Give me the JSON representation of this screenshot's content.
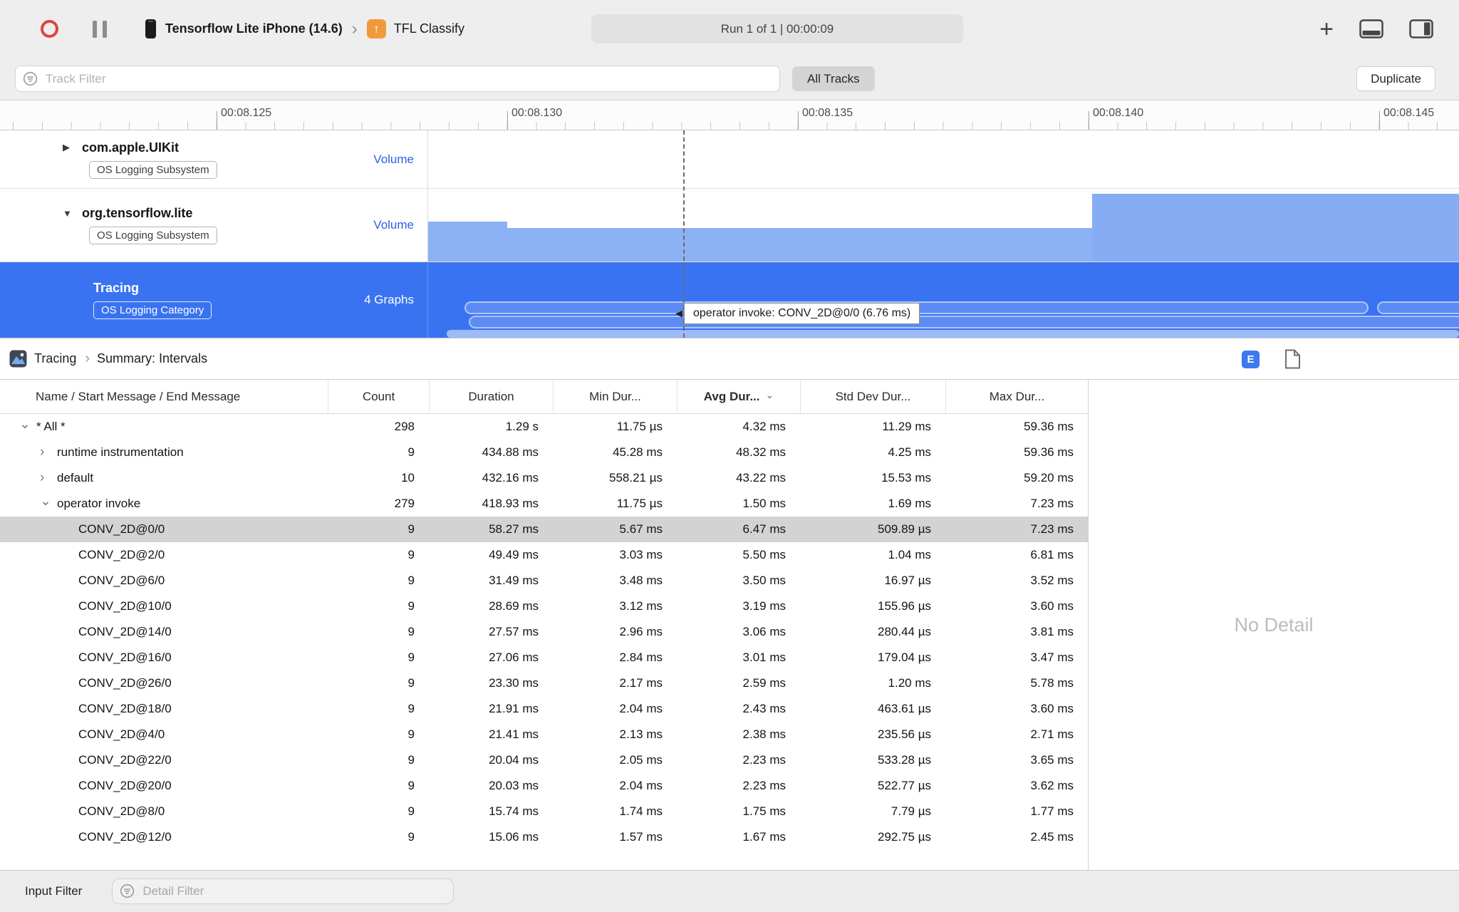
{
  "toolbar": {
    "device": "Tensorflow Lite iPhone (14.6)",
    "target": "TFL Classify",
    "run_status": "Run 1 of 1  |  00:00:09"
  },
  "filter_bar": {
    "track_filter_placeholder": "Track Filter",
    "all_tracks_label": "All Tracks",
    "duplicate_label": "Duplicate"
  },
  "ruler": {
    "ticks": [
      "00:08.125",
      "00:08.130",
      "00:08.135",
      "00:08.140",
      "00:08.145"
    ]
  },
  "tracks": [
    {
      "name": "com.apple.UIKit",
      "badge": "OS Logging Subsystem",
      "meta": "Volume",
      "state": "collapsed"
    },
    {
      "name": "org.tensorflow.lite",
      "badge": "OS Logging Subsystem",
      "meta": "Volume",
      "state": "expanded"
    },
    {
      "name": "Tracing",
      "badge": "OS Logging Category",
      "meta": "4 Graphs",
      "state": "selected"
    }
  ],
  "timeline": {
    "tooltip": "operator invoke: CONV_2D@0/0 (6.76 ms)"
  },
  "detail": {
    "breadcrumb": [
      "Tracing",
      "Summary: Intervals"
    ],
    "editor_badge": "E",
    "no_detail": "No Detail",
    "columns": [
      "Name / Start Message / End Message",
      "Count",
      "Duration",
      "Min Dur...",
      "Avg Dur...",
      "Std Dev Dur...",
      "Max Dur..."
    ],
    "sorted_column_index": 4,
    "rows": [
      {
        "level": 0,
        "expander": "open",
        "selected": false,
        "name": "* All *",
        "count": "298",
        "duration": "1.29 s",
        "min": "11.75 µs",
        "avg": "4.32 ms",
        "std": "11.29 ms",
        "max": "59.36 ms"
      },
      {
        "level": 1,
        "expander": "closed",
        "selected": false,
        "name": "runtime instrumentation",
        "count": "9",
        "duration": "434.88 ms",
        "min": "45.28 ms",
        "avg": "48.32 ms",
        "std": "4.25 ms",
        "max": "59.36 ms"
      },
      {
        "level": 1,
        "expander": "closed",
        "selected": false,
        "name": "default",
        "count": "10",
        "duration": "432.16 ms",
        "min": "558.21 µs",
        "avg": "43.22 ms",
        "std": "15.53 ms",
        "max": "59.20 ms"
      },
      {
        "level": 1,
        "expander": "open",
        "selected": false,
        "name": "operator invoke",
        "count": "279",
        "duration": "418.93 ms",
        "min": "11.75 µs",
        "avg": "1.50 ms",
        "std": "1.69 ms",
        "max": "7.23 ms"
      },
      {
        "level": 2,
        "expander": null,
        "selected": true,
        "name": "CONV_2D@0/0",
        "count": "9",
        "duration": "58.27 ms",
        "min": "5.67 ms",
        "avg": "6.47 ms",
        "std": "509.89 µs",
        "max": "7.23 ms"
      },
      {
        "level": 2,
        "expander": null,
        "selected": false,
        "name": "CONV_2D@2/0",
        "count": "9",
        "duration": "49.49 ms",
        "min": "3.03 ms",
        "avg": "5.50 ms",
        "std": "1.04 ms",
        "max": "6.81 ms"
      },
      {
        "level": 2,
        "expander": null,
        "selected": false,
        "name": "CONV_2D@6/0",
        "count": "9",
        "duration": "31.49 ms",
        "min": "3.48 ms",
        "avg": "3.50 ms",
        "std": "16.97 µs",
        "max": "3.52 ms"
      },
      {
        "level": 2,
        "expander": null,
        "selected": false,
        "name": "CONV_2D@10/0",
        "count": "9",
        "duration": "28.69 ms",
        "min": "3.12 ms",
        "avg": "3.19 ms",
        "std": "155.96 µs",
        "max": "3.60 ms"
      },
      {
        "level": 2,
        "expander": null,
        "selected": false,
        "name": "CONV_2D@14/0",
        "count": "9",
        "duration": "27.57 ms",
        "min": "2.96 ms",
        "avg": "3.06 ms",
        "std": "280.44 µs",
        "max": "3.81 ms"
      },
      {
        "level": 2,
        "expander": null,
        "selected": false,
        "name": "CONV_2D@16/0",
        "count": "9",
        "duration": "27.06 ms",
        "min": "2.84 ms",
        "avg": "3.01 ms",
        "std": "179.04 µs",
        "max": "3.47 ms"
      },
      {
        "level": 2,
        "expander": null,
        "selected": false,
        "name": "CONV_2D@26/0",
        "count": "9",
        "duration": "23.30 ms",
        "min": "2.17 ms",
        "avg": "2.59 ms",
        "std": "1.20 ms",
        "max": "5.78 ms"
      },
      {
        "level": 2,
        "expander": null,
        "selected": false,
        "name": "CONV_2D@18/0",
        "count": "9",
        "duration": "21.91 ms",
        "min": "2.04 ms",
        "avg": "2.43 ms",
        "std": "463.61 µs",
        "max": "3.60 ms"
      },
      {
        "level": 2,
        "expander": null,
        "selected": false,
        "name": "CONV_2D@4/0",
        "count": "9",
        "duration": "21.41 ms",
        "min": "2.13 ms",
        "avg": "2.38 ms",
        "std": "235.56 µs",
        "max": "2.71 ms"
      },
      {
        "level": 2,
        "expander": null,
        "selected": false,
        "name": "CONV_2D@22/0",
        "count": "9",
        "duration": "20.04 ms",
        "min": "2.05 ms",
        "avg": "2.23 ms",
        "std": "533.28 µs",
        "max": "3.65 ms"
      },
      {
        "level": 2,
        "expander": null,
        "selected": false,
        "name": "CONV_2D@20/0",
        "count": "9",
        "duration": "20.03 ms",
        "min": "2.04 ms",
        "avg": "2.23 ms",
        "std": "522.77 µs",
        "max": "3.62 ms"
      },
      {
        "level": 2,
        "expander": null,
        "selected": false,
        "name": "CONV_2D@8/0",
        "count": "9",
        "duration": "15.74 ms",
        "min": "1.74 ms",
        "avg": "1.75 ms",
        "std": "7.79 µs",
        "max": "1.77 ms"
      },
      {
        "level": 2,
        "expander": null,
        "selected": false,
        "name": "CONV_2D@12/0",
        "count": "9",
        "duration": "15.06 ms",
        "min": "1.57 ms",
        "avg": "1.67 ms",
        "std": "292.75 µs",
        "max": "2.45 ms"
      }
    ]
  },
  "bottom_bar": {
    "input_filter_label": "Input Filter",
    "detail_filter_placeholder": "Detail Filter"
  },
  "icons": {
    "add": "+",
    "toolbar_chevron": "›",
    "breadcrumb_chevron": "›",
    "sort_chevron": "⌄",
    "tooltip_arrow": "◀",
    "collapsed_triangle": "▶",
    "expanded_triangle": "▼",
    "target_arrow": "↑",
    "expander_open": "⌄",
    "expander_closed": "›"
  },
  "colors": {
    "accent_blue": "#3a73f1",
    "volume_bar": "#8db1f5",
    "selected_row": "#d3d3d3",
    "editor_badge_blue": "#3f78ef",
    "record_red": "#e0433e"
  }
}
